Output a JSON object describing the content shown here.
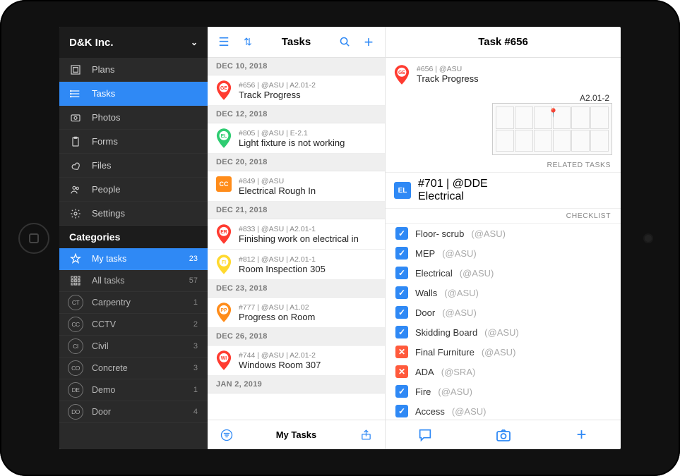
{
  "company": "D&K Inc.",
  "nav": [
    {
      "icon": "plans",
      "label": "Plans",
      "active": false
    },
    {
      "icon": "tasks",
      "label": "Tasks",
      "active": true
    },
    {
      "icon": "photos",
      "label": "Photos",
      "active": false
    },
    {
      "icon": "forms",
      "label": "Forms",
      "active": false
    },
    {
      "icon": "files",
      "label": "Files",
      "active": false
    },
    {
      "icon": "people",
      "label": "People",
      "active": false
    },
    {
      "icon": "settings",
      "label": "Settings",
      "active": false
    }
  ],
  "categories_title": "Categories",
  "categories": [
    {
      "icon": "star",
      "label": "My tasks",
      "count": "23",
      "active": true
    },
    {
      "icon": "grid",
      "label": "All tasks",
      "count": "57"
    },
    {
      "code": "CT",
      "label": "Carpentry",
      "count": "1"
    },
    {
      "code": "CC",
      "label": "CCTV",
      "count": "2"
    },
    {
      "code": "CI",
      "label": "Civil",
      "count": "3"
    },
    {
      "code": "CO",
      "label": "Concrete",
      "count": "3"
    },
    {
      "code": "DE",
      "label": "Demo",
      "count": "1"
    },
    {
      "code": "DO",
      "label": "Door",
      "count": "4"
    }
  ],
  "mid": {
    "title": "Tasks",
    "footer": "My Tasks",
    "groups": [
      {
        "date": "DEC 10, 2018",
        "items": [
          {
            "pin": "GE",
            "color": "#ff3b30",
            "meta": "#656 | @ASU | A2.01-2",
            "name": "Track Progress"
          }
        ]
      },
      {
        "date": "DEC 12, 2018",
        "items": [
          {
            "pin": "EL",
            "color": "#2ecc71",
            "meta": "#805 | @ASU | E-2.1",
            "name": "Light fixture is not working"
          }
        ]
      },
      {
        "date": "DEC 20, 2018",
        "items": [
          {
            "pin": "CC",
            "color": "#ff8c1a",
            "shape": "square",
            "meta": "#849 | @ASU",
            "name": "Electrical Rough In"
          }
        ]
      },
      {
        "date": "DEC 21, 2018",
        "items": [
          {
            "pin": "ER",
            "color": "#ff3b30",
            "meta": "#833 | @ASU | A2.01-1",
            "name": "Finishing work on electrical in"
          },
          {
            "pin": "FI",
            "color": "#ffd92e",
            "meta": "#812 | @ASU | A2.01-1",
            "name": "Room Inspection 305"
          }
        ]
      },
      {
        "date": "DEC 23, 2018",
        "items": [
          {
            "pin": "PP",
            "color": "#ff8c1a",
            "meta": "#777 | @ASU | A1.02",
            "name": "Progress on Room"
          }
        ]
      },
      {
        "date": "DEC 26, 2018",
        "items": [
          {
            "pin": "WI",
            "color": "#ff3b30",
            "meta": "#744 | @ASU | A2.01-2",
            "name": "Windows Room 307"
          }
        ]
      },
      {
        "date": "JAN 2, 2019",
        "items": []
      }
    ]
  },
  "detail": {
    "title": "Task #656",
    "pin": {
      "code": "GE",
      "color": "#ff3b30"
    },
    "meta": "#656 | @ASU",
    "name": "Track Progress",
    "plan_label": "A2.01-2",
    "related_label": "RELATED TASKS",
    "related": [
      {
        "code": "EL",
        "color": "#2f89f5",
        "meta": "#701 | @DDE",
        "name": "Electrical"
      }
    ],
    "checklist_label": "CHECKLIST",
    "checklist": [
      {
        "done": true,
        "label": "Floor- scrub",
        "who": "(@ASU)"
      },
      {
        "done": true,
        "label": "MEP",
        "who": "(@ASU)"
      },
      {
        "done": true,
        "label": "Electrical",
        "who": "(@ASU)"
      },
      {
        "done": true,
        "label": "Walls",
        "who": "(@ASU)"
      },
      {
        "done": true,
        "label": "Door",
        "who": "(@ASU)"
      },
      {
        "done": true,
        "label": "Skidding Board",
        "who": "(@ASU)"
      },
      {
        "done": false,
        "label": "Final Furniture",
        "who": "(@ASU)"
      },
      {
        "done": false,
        "label": "ADA",
        "who": "(@SRA)"
      },
      {
        "done": true,
        "label": "Fire",
        "who": "(@ASU)"
      },
      {
        "done": true,
        "label": "Access",
        "who": "(@ASU)"
      }
    ]
  }
}
